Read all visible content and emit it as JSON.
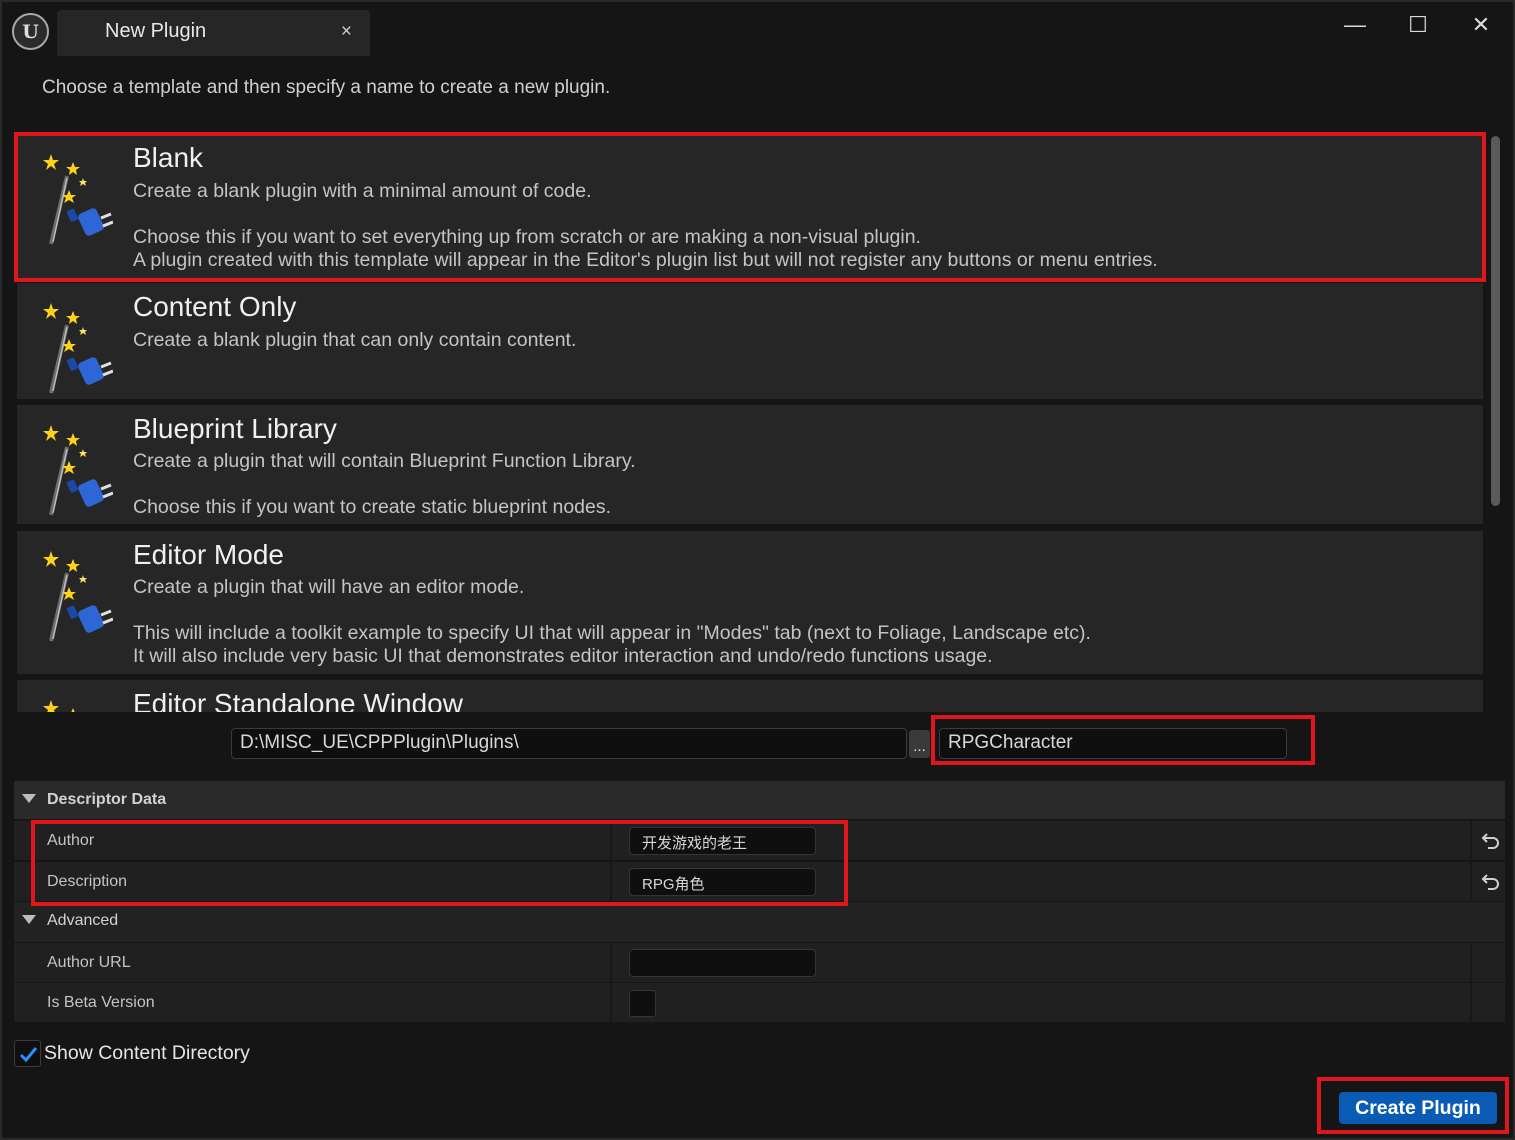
{
  "window": {
    "tab_title": "New Plugin",
    "tab_close": "×",
    "minimize": "—",
    "maximize": "☐",
    "close": "✕"
  },
  "subtitle": "Choose a template and then specify a name to create a new plugin.",
  "templates": [
    {
      "title": "Blank",
      "lines": [
        "Create a blank plugin with a minimal amount of code.",
        "Choose this if you want to set everything up from scratch or are making a non-visual plugin.",
        "A plugin created with this template will appear in the Editor's plugin list but will not register any buttons or menu entries."
      ],
      "icon": "plugin-wand-icon"
    },
    {
      "title": "Content Only",
      "lines": [
        "Create a blank plugin that can only contain content."
      ],
      "icon": "plugin-wand-icon"
    },
    {
      "title": "Blueprint Library",
      "lines": [
        "Create a plugin that will contain Blueprint Function Library.",
        "Choose this if you want to create static blueprint nodes."
      ],
      "icon": "plugin-wand-icon"
    },
    {
      "title": "Editor Mode",
      "lines": [
        "Create a plugin that will have an editor mode.",
        "This will include a toolkit example to specify UI that will appear in \"Modes\" tab (next to Foliage, Landscape etc).",
        "It will also include very basic UI that demonstrates editor interaction and undo/redo functions usage."
      ],
      "icon": "plugin-wand-icon"
    },
    {
      "title": "Editor Standalone Window",
      "lines": [],
      "icon": "plugin-wand-icon"
    }
  ],
  "path": {
    "value": "D:\\MISC_UE\\CPPPlugin\\Plugins\\",
    "browse_label": "...",
    "name_value": "RPGCharacter"
  },
  "details": {
    "descriptor_category": "Descriptor Data",
    "author_label": "Author",
    "author_value": "开发游戏的老王",
    "description_label": "Description",
    "description_value": "RPG角色",
    "advanced_category": "Advanced",
    "author_url_label": "Author URL",
    "author_url_value": "",
    "beta_label": "Is Beta Version"
  },
  "show_content_label": "Show Content Directory",
  "create_button": "Create Plugin",
  "colors": {
    "highlight": "#e0161d",
    "accent": "#0a5bb5",
    "checkbox_check": "#2f8cff"
  }
}
